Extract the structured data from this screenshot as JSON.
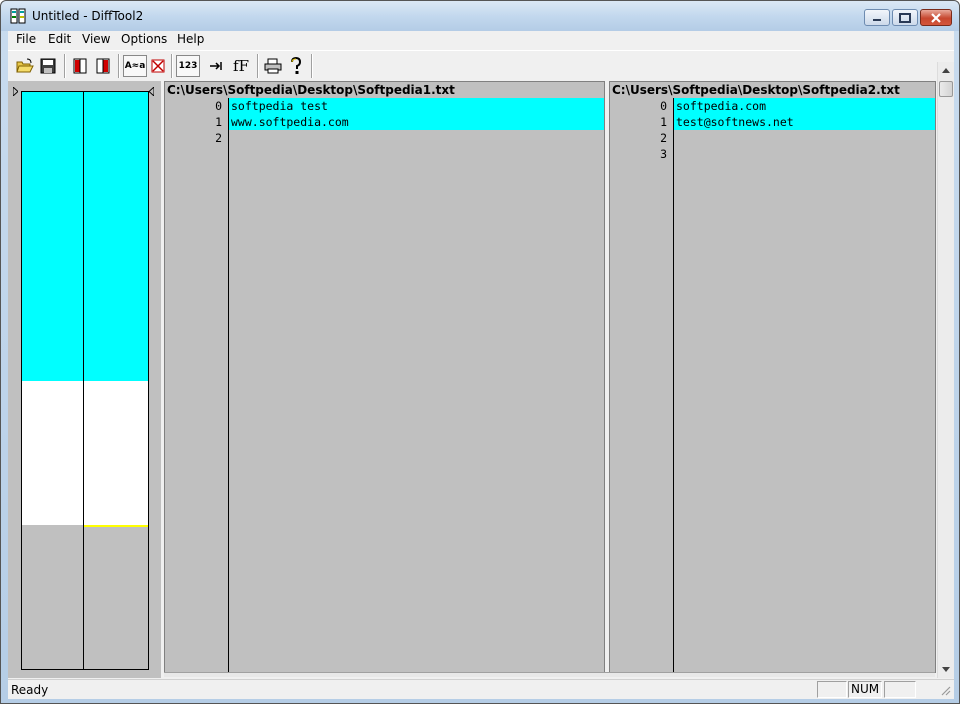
{
  "window": {
    "title": "Untitled - DiffTool2"
  },
  "menu": [
    "File",
    "Edit",
    "View",
    "Options",
    "Help"
  ],
  "toolbar": {
    "buttons": [
      "open-icon",
      "save-icon",
      "left-file-icon",
      "right-file-icon",
      "match-case-icon",
      "ignore-icon",
      "line-numbers-icon",
      "tab-icon",
      "font-icon",
      "print-icon",
      "help-icon"
    ],
    "labels": {
      "match_case": "A≈a",
      "line_numbers": "123",
      "font": "fF"
    }
  },
  "overview": {
    "left_segments": [
      {
        "kind": "changed",
        "color": "#00ffff",
        "fraction": 0.5
      },
      {
        "kind": "empty",
        "color": "#ffffff",
        "fraction": 0.25
      },
      {
        "kind": "none",
        "color": "#c0c0c0",
        "fraction": 0.25
      }
    ],
    "right_segments": [
      {
        "kind": "changed",
        "color": "#00ffff",
        "fraction": 0.5
      },
      {
        "kind": "empty",
        "color": "#ffffff",
        "fraction": 0.25
      },
      {
        "kind": "added",
        "color": "#ffff00",
        "fraction": 0.004
      },
      {
        "kind": "none",
        "color": "#c0c0c0",
        "fraction": 0.246
      }
    ]
  },
  "left_file": {
    "path": "C:\\Users\\Softpedia\\Desktop\\Softpedia1.txt",
    "lines": [
      {
        "num": "0",
        "text": "softpedia test",
        "color": "#00ffff"
      },
      {
        "num": "1",
        "text": "www.softpedia.com",
        "color": "#00ffff"
      },
      {
        "num": "2",
        "text": "",
        "color": "#ffffff"
      }
    ]
  },
  "right_file": {
    "path": "C:\\Users\\Softpedia\\Desktop\\Softpedia2.txt",
    "lines": [
      {
        "num": "0",
        "text": "softpedia.com",
        "color": "#00ffff"
      },
      {
        "num": "1",
        "text": "test@softnews.net",
        "color": "#00ffff"
      },
      {
        "num": "2",
        "text": "",
        "color": "#ffffff"
      },
      {
        "num": "3",
        "text": "",
        "color": "#ffff00"
      }
    ]
  },
  "status": {
    "text": "Ready",
    "panes": [
      "",
      "NUM",
      ""
    ]
  },
  "colors": {
    "changed": "#00ffff",
    "added": "#ffff00",
    "background": "#c0c0c0"
  }
}
